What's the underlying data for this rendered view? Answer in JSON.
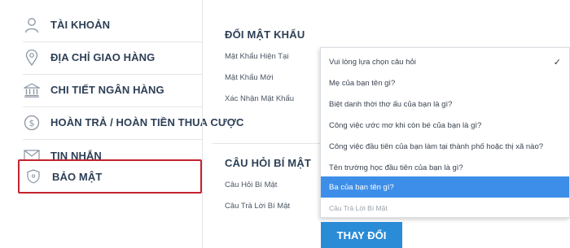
{
  "sidebar": {
    "items": [
      {
        "label": "TÀI KHOẢN",
        "icon": "user-icon"
      },
      {
        "label": "ĐỊA CHỈ GIAO HÀNG",
        "icon": "location-pin-icon"
      },
      {
        "label": "CHI TIẾT NGÂN HÀNG",
        "icon": "bank-icon"
      },
      {
        "label": "HOÀN TRẢ / HOÀN TIỀN THUA CƯỢC",
        "icon": "dollar-refund-icon"
      },
      {
        "label": "TIN NHẮN",
        "icon": "envelope-icon"
      },
      {
        "label": "BẢO MẬT",
        "icon": "shield-icon",
        "active": true
      }
    ]
  },
  "password_section": {
    "title": "ĐỔI MẬT KHẨU",
    "current_label": "Mật Khẩu Hiện Tại",
    "new_label": "Mật Khẩu Mới",
    "confirm_label": "Xác Nhận Mật Khẩu"
  },
  "secret_section": {
    "title": "CÂU HỎI BÍ MẬT",
    "question_label": "Câu Hỏi Bí Mật",
    "answer_label": "Câu Trả Lời Bí Mật"
  },
  "dropdown": {
    "options": [
      "Vui lòng lựa chọn câu hỏi",
      "Mẹ của bạn tên gì?",
      "Biệt danh thời thơ ấu của bạn là gì?",
      "Công việc ước mơ khi còn bé của bạn là gì?",
      "Công việc đầu tiên của bạn làm tại thành phố hoặc thị xã nào?",
      "Tên trường học đầu tiên của bạn là gì?",
      "Ba của bạn tên gì?"
    ],
    "checked_index": 0,
    "highlighted_index": 6,
    "answer_placeholder": "Câu Trả Lời Bí Mật",
    "check_mark": "✓"
  },
  "submit": {
    "label": "THAY ĐỔI"
  },
  "colors": {
    "accent": "#2a8bd6",
    "highlight": "#3d8ee8",
    "active_border": "#c4232f",
    "text": "#2d3f56"
  }
}
